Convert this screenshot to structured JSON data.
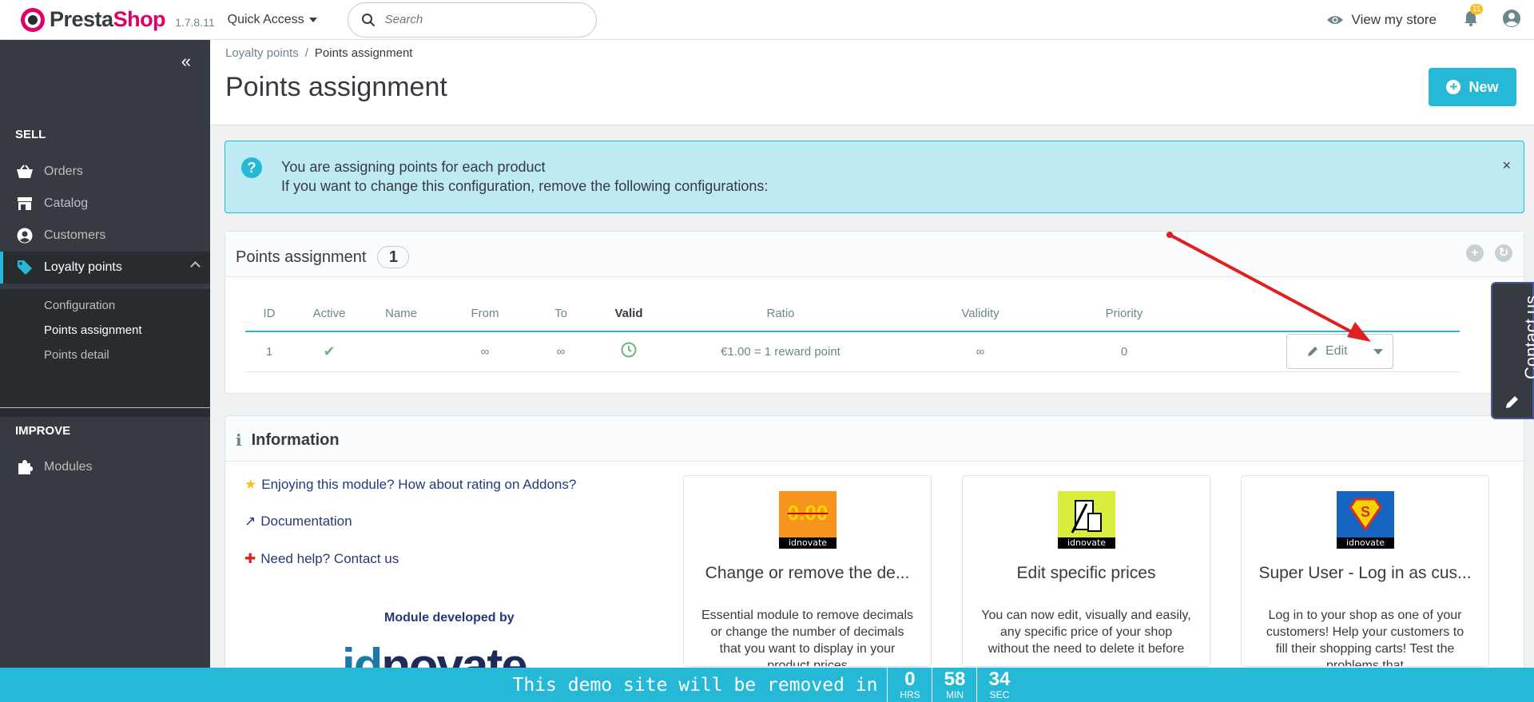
{
  "header": {
    "logo_part1": "Presta",
    "logo_part2": "Shop",
    "version": "1.7.8.11",
    "quick_access": "Quick Access",
    "search_placeholder": "Search",
    "view_store": "View my store",
    "notifications_count": "11"
  },
  "sidebar": {
    "sell_title": "SELL",
    "items": [
      {
        "label": "Orders",
        "icon": "basket-icon"
      },
      {
        "label": "Catalog",
        "icon": "store-icon"
      },
      {
        "label": "Customers",
        "icon": "user-circle-icon"
      },
      {
        "label": "Loyalty points",
        "icon": "tag-icon"
      }
    ],
    "submenu": [
      "Configuration",
      "Points assignment",
      "Points detail"
    ],
    "improve_title": "IMPROVE",
    "modules": "Modules"
  },
  "page": {
    "breadcrumb_parent": "Loyalty points",
    "breadcrumb_current": "Points assignment",
    "title": "Points assignment",
    "new_button": "New"
  },
  "alert": {
    "line1": "You are assigning points for each product",
    "line2": "If you want to change this configuration, remove the following configurations:"
  },
  "points_panel": {
    "title": "Points assignment",
    "count": "1",
    "columns": [
      "ID",
      "Active",
      "Name",
      "From",
      "To",
      "Valid",
      "Ratio",
      "Validity",
      "Priority"
    ],
    "row": {
      "id": "1",
      "active": "✔",
      "name": "",
      "from": "∞",
      "to": "∞",
      "ratio": "€1.00 = 1 reward point",
      "validity": "∞",
      "priority": "0"
    },
    "edit_button": "Edit"
  },
  "info_panel": {
    "title": "Information",
    "links": [
      "Enjoying this module? How about rating on Addons?",
      "Documentation",
      "Need help? Contact us"
    ],
    "module_by": "Module developed by",
    "brand_id": "id",
    "brand_rest": "novate",
    "cards": [
      {
        "logo_text": "0.00",
        "tag": "idnovate",
        "title": "Change or remove the de...",
        "desc": "Essential module to remove decimals or change the number of decimals that you want to display in your product prices"
      },
      {
        "logo_text": "",
        "tag": "idnovate",
        "title": "Edit specific prices",
        "desc": "You can now edit, visually and easily, any specific price of your shop without the need to delete it before"
      },
      {
        "logo_text": "S",
        "tag": "idnovate",
        "title": "Super User - Log in as cus...",
        "desc": "Log in to your shop as one of your customers! Help your customers to fill their shopping carts! Test the problems that"
      }
    ]
  },
  "contact_tab": "Contact us",
  "countdown": {
    "text": "This demo site will be removed in",
    "hrs": "0",
    "hrs_label": "HRS",
    "min": "58",
    "min_label": "MIN",
    "sec": "34",
    "sec_label": "SEC"
  },
  "colors": {
    "accent": "#25b9d7",
    "brand": "#df0067",
    "sidebar": "#363a41",
    "arrow": "#e02020"
  }
}
